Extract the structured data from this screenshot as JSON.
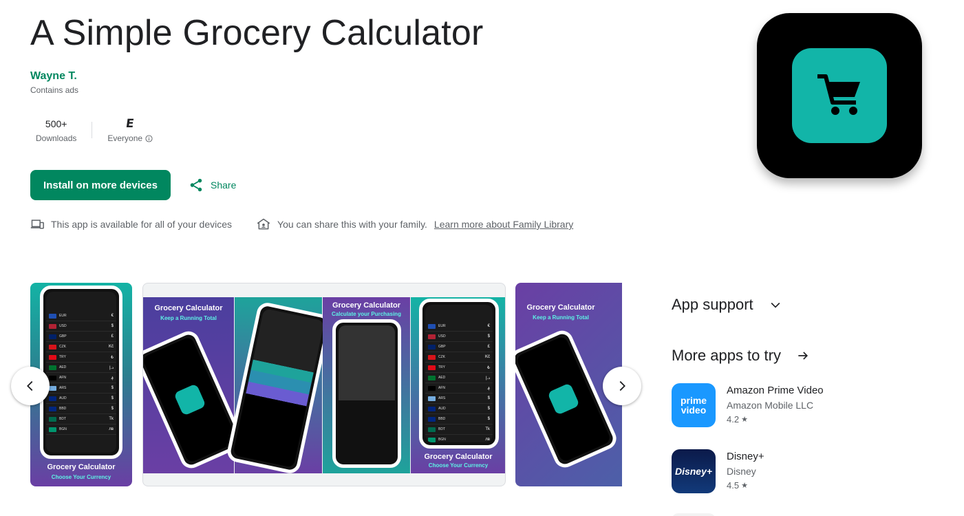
{
  "app": {
    "title": "A Simple Grocery Calculator",
    "developer": "Wayne T.",
    "ads_note": "Contains ads",
    "icon": "shopping-cart-icon",
    "colors": {
      "accent": "#01875f",
      "icon_bg": "#000000",
      "icon_inner": "#12b5a8"
    }
  },
  "stats": {
    "downloads_value": "500+",
    "downloads_label": "Downloads",
    "rating_value": "E",
    "rating_label": "Everyone"
  },
  "actions": {
    "install_label": "Install on more devices",
    "share_label": "Share"
  },
  "availability": {
    "devices_text": "This app is available for all of your devices",
    "family_text": "You can share this with your family.",
    "family_link": "Learn more about Family Library"
  },
  "screenshots": {
    "shot1": {
      "title": "Grocery Calculator",
      "subtitle": "Choose Your Currency"
    },
    "shot2a": {
      "title": "Grocery Calculator",
      "subtitle": "Keep a Running Total"
    },
    "shot2b": {
      "title": "Grocery Calculator",
      "subtitle": "Calculate your Purchasing"
    },
    "shot2c": {
      "title": "Grocery Calculator",
      "subtitle": "Choose Your Currency"
    },
    "shot3": {
      "title": "Grocery Calculator",
      "subtitle": "Keep a Running Total"
    },
    "currencies": [
      {
        "code": "EUR",
        "sym": "€"
      },
      {
        "code": "USD",
        "sym": "$"
      },
      {
        "code": "GBP",
        "sym": "£"
      },
      {
        "code": "CZK",
        "sym": "Kč"
      },
      {
        "code": "TRY",
        "sym": "₺"
      },
      {
        "code": "AED",
        "sym": "د.إ"
      },
      {
        "code": "AFN",
        "sym": "؋"
      },
      {
        "code": "ARS",
        "sym": "$"
      },
      {
        "code": "AUD",
        "sym": "$"
      },
      {
        "code": "BBD",
        "sym": "$"
      },
      {
        "code": "BDT",
        "sym": "Tk"
      },
      {
        "code": "BGN",
        "sym": "лв"
      }
    ]
  },
  "sidebar": {
    "app_support": "App support",
    "more_apps": "More apps to try",
    "apps": [
      {
        "name": "Amazon Prime Video",
        "developer": "Amazon Mobile LLC",
        "rating": "4.2",
        "icon_text_1": "prime",
        "icon_text_2": "video"
      },
      {
        "name": "Disney+",
        "developer": "Disney",
        "rating": "4.5",
        "icon_text_1": "Disney+"
      }
    ]
  }
}
